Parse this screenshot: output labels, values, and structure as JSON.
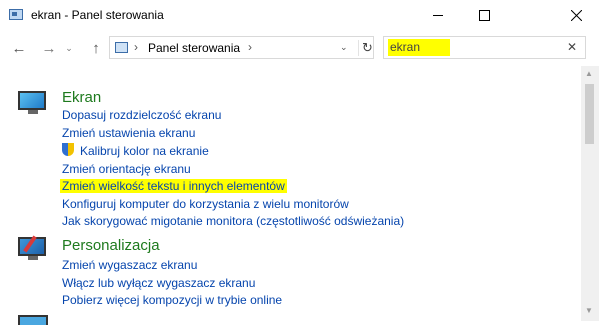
{
  "window": {
    "title": "ekran - Panel sterowania"
  },
  "address": {
    "path": "Panel sterowania"
  },
  "search": {
    "value": "ekran"
  },
  "categories": [
    {
      "title": "Ekran",
      "links": [
        "Dopasuj rozdzielczość ekranu",
        "Zmień ustawienia ekranu",
        "Kalibruj kolor na ekranie",
        "Zmień orientację ekranu",
        "Zmień wielkość tekstu i innych elementów",
        "Konfiguruj komputer do korzystania z wielu monitorów",
        "Jak skorygować migotanie monitora (częstotliwość odświeżania)"
      ]
    },
    {
      "title": "Personalizacja",
      "links": [
        "Zmień wygaszacz ekranu",
        "Włącz lub wyłącz wygaszacz ekranu",
        "Pobierz więcej kompozycji w trybie online"
      ]
    }
  ],
  "highlight_color": "#ffff00",
  "link_color": "#0645ad",
  "category_color": "#1e7a1e"
}
